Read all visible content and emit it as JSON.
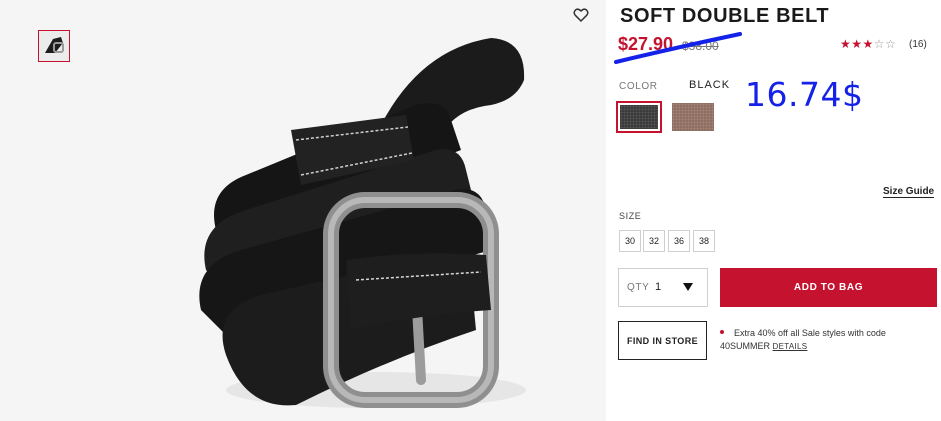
{
  "product": {
    "title": "SOFT DOUBLE BELT",
    "sale_price": "$27.90",
    "original_price": "$38.00",
    "rating": {
      "value": 3,
      "max": 5,
      "reviews": "(16)"
    },
    "handwritten_price": "16.74$"
  },
  "color": {
    "label": "COLOR",
    "selected": "BLACK",
    "swatches": [
      {
        "name": "black",
        "color": "#3a3a3a",
        "selected": true
      },
      {
        "name": "brown",
        "color": "#8d6e63",
        "selected": false
      }
    ]
  },
  "size": {
    "label": "SIZE",
    "guide_label": "Size Guide",
    "options": [
      "30",
      "32",
      "36",
      "38"
    ]
  },
  "quantity": {
    "label": "QTY",
    "value": "1"
  },
  "actions": {
    "add_to_bag": "ADD TO BAG",
    "find_in_store": "FIND IN STORE"
  },
  "promo": {
    "line1": "Extra 40% off all Sale styles with code",
    "line2": "40SUMMER",
    "link": "DETAILS"
  },
  "colors": {
    "accent": "#c4122f",
    "annotation": "#1421e8"
  }
}
